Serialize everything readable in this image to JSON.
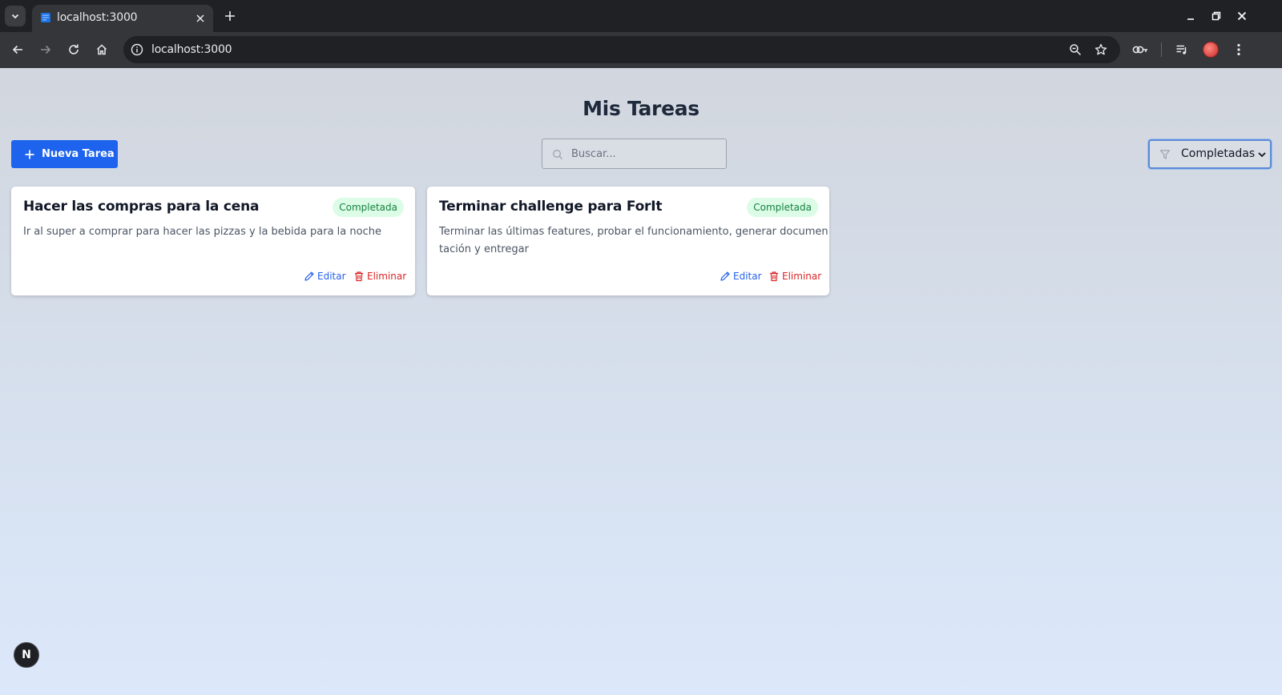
{
  "browser": {
    "tab_title": "localhost:3000",
    "url": "localhost:3000"
  },
  "page": {
    "title": "Mis Tareas",
    "new_task_label": "Nueva Tarea",
    "search_placeholder": "Buscar...",
    "filter": {
      "selected": "Completadas"
    },
    "tasks": [
      {
        "title": "Hacer las compras para la cena",
        "status": "Completada",
        "description_lines": [
          "Ir al super a comprar para hacer las pizzas y la bebida para la noche"
        ],
        "edit_label": "Editar",
        "delete_label": "Eliminar"
      },
      {
        "title": "Terminar challenge para ForIt",
        "status": "Completada",
        "description_lines": [
          "Terminar las últimas features, probar el funcionamiento, generar documen",
          "tación y entregar"
        ],
        "edit_label": "Editar",
        "delete_label": "Eliminar"
      }
    ],
    "dev_badge": "N"
  },
  "colors": {
    "primary": "#1d63ed",
    "badge_bg": "#dcfce7",
    "badge_text": "#15803d",
    "edit": "#2563eb",
    "delete": "#dc2626"
  }
}
